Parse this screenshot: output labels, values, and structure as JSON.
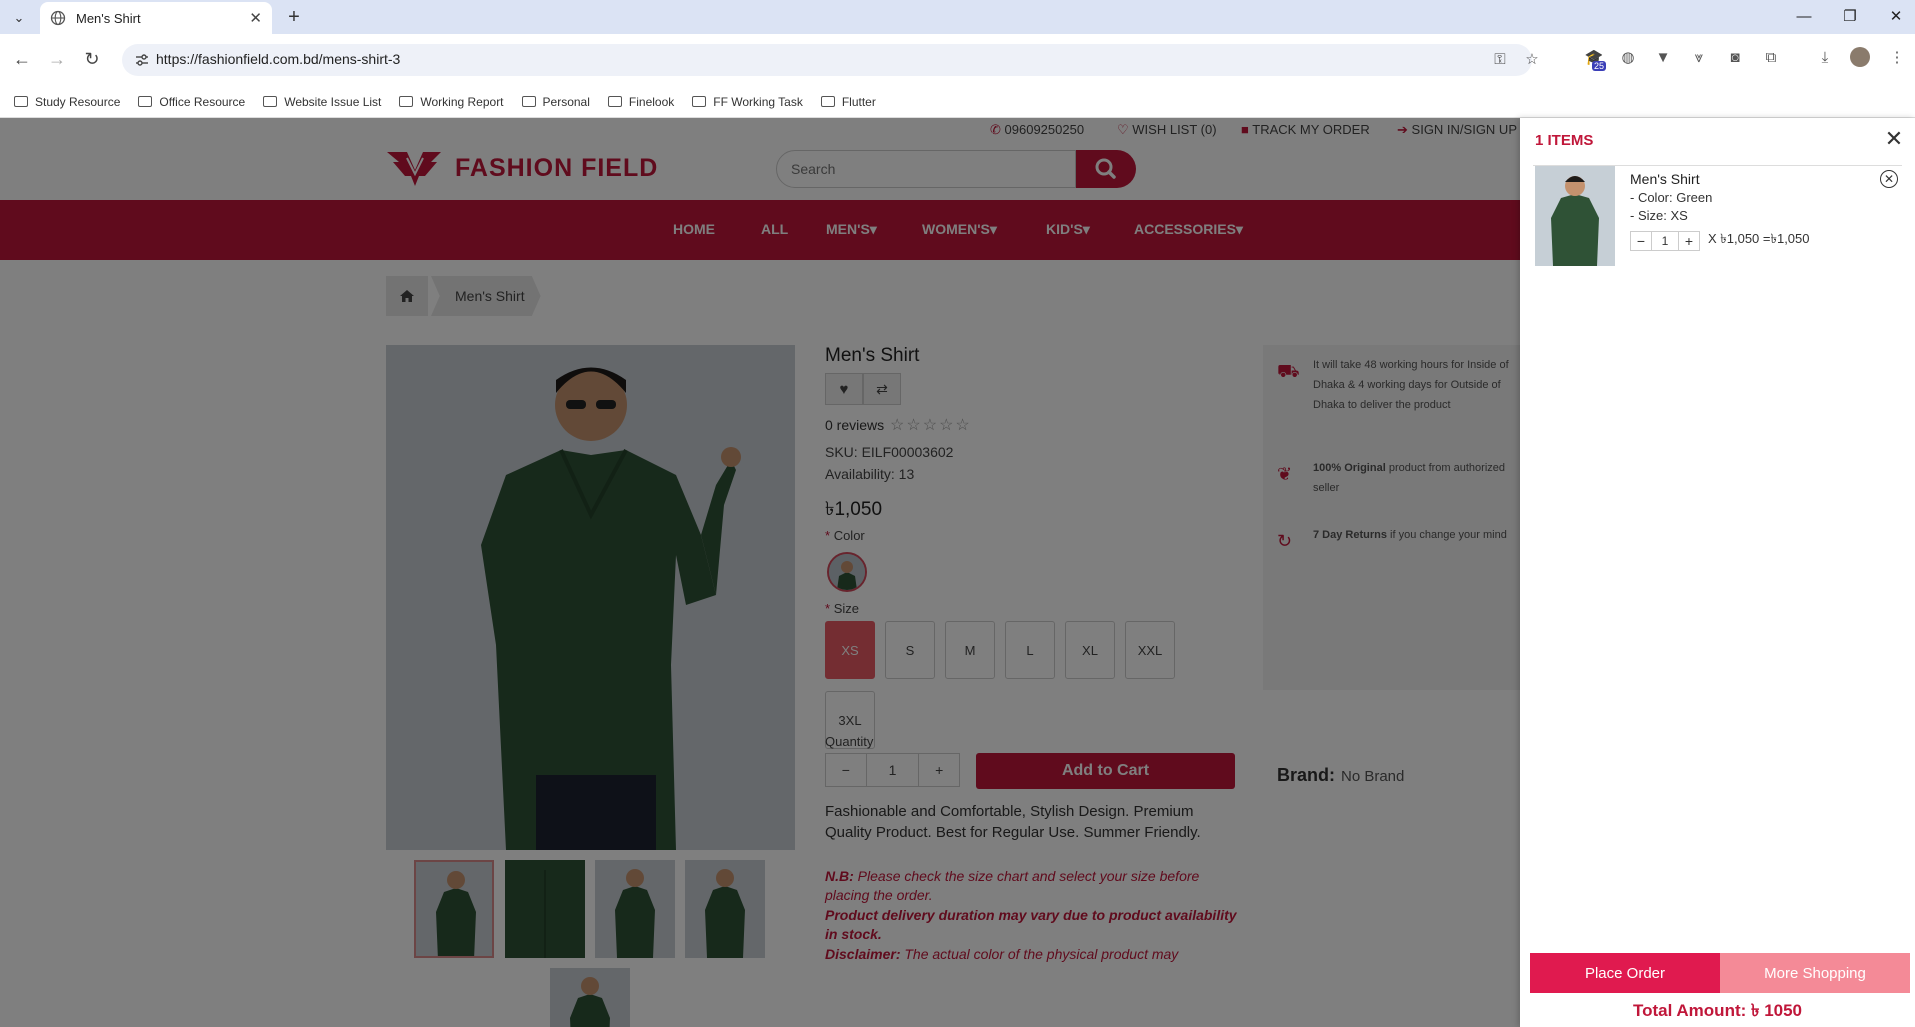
{
  "browser": {
    "tab_title": "Men's Shirt",
    "url": "https://fashionfield.com.bd/mens-shirt-3",
    "extension_badge": "25",
    "bookmarks": [
      "Study Resource",
      "Office Resource",
      "Website Issue List",
      "Working Report",
      "Personal",
      "Finelook",
      "FF Working Task",
      "Flutter"
    ]
  },
  "site": {
    "phone": "09609250250",
    "wishlist": "WISH LIST (0)",
    "track": "TRACK MY ORDER",
    "signin": "SIGN IN/SIGN UP",
    "logo": "FASHION FIELD",
    "search_placeholder": "Search",
    "nav": [
      "HOME",
      "ALL",
      "MEN'S",
      "WOMEN'S",
      "KID'S",
      "ACCESSORIES"
    ],
    "breadcrumb": "Men's Shirt"
  },
  "product": {
    "title": "Men's Shirt",
    "reviews": "0 reviews",
    "sku_label": "SKU:",
    "sku": "EILF00003602",
    "availability_label": "Availability:",
    "availability": "13",
    "price": "৳1,050",
    "color_label": "Color",
    "size_label": "Size",
    "sizes": [
      "XS",
      "S",
      "M",
      "L",
      "XL",
      "XXL",
      "3XL"
    ],
    "selected_size": "XS",
    "quantity_label": "Quantity",
    "quantity": "1",
    "add_to_cart": "Add to Cart",
    "description": "Fashionable and Comfortable, Stylish Design. Premium Quality Product. Best for Regular Use. Summer Friendly.",
    "nb_label": "N.B:",
    "nb_text": "Please check the size chart and select your size before placing the order.",
    "delivery_note": "Product delivery duration may vary due to product availability in stock.",
    "disclaimer_label": "Disclaimer:",
    "disclaimer_text": "The actual color of the physical product may"
  },
  "sidebar": {
    "delivery": "It will take 48 working hours for Inside of Dhaka & 4 working days for Outside of Dhaka to deliver the product",
    "original_bold": "100% Original",
    "original_rest": "product from authorized seller",
    "returns_bold": "7 Day Returns",
    "returns_rest": "if you change your mind",
    "brand_label": "Brand:",
    "brand_value": "No Brand"
  },
  "cart": {
    "title": "1 ITEMS",
    "item_name": "Men's Shirt",
    "item_color": "- Color: Green",
    "item_size": "- Size: XS",
    "item_qty": "1",
    "item_line": "X ৳1,050 =৳1,050",
    "place_order": "Place Order",
    "more_shopping": "More Shopping",
    "total": "Total Amount: ৳ 1050"
  },
  "colors": {
    "brand": "#c0173a",
    "place_order": "#e01a4f",
    "more_shopping": "#f48a97",
    "selected_size": "#e85a64"
  }
}
